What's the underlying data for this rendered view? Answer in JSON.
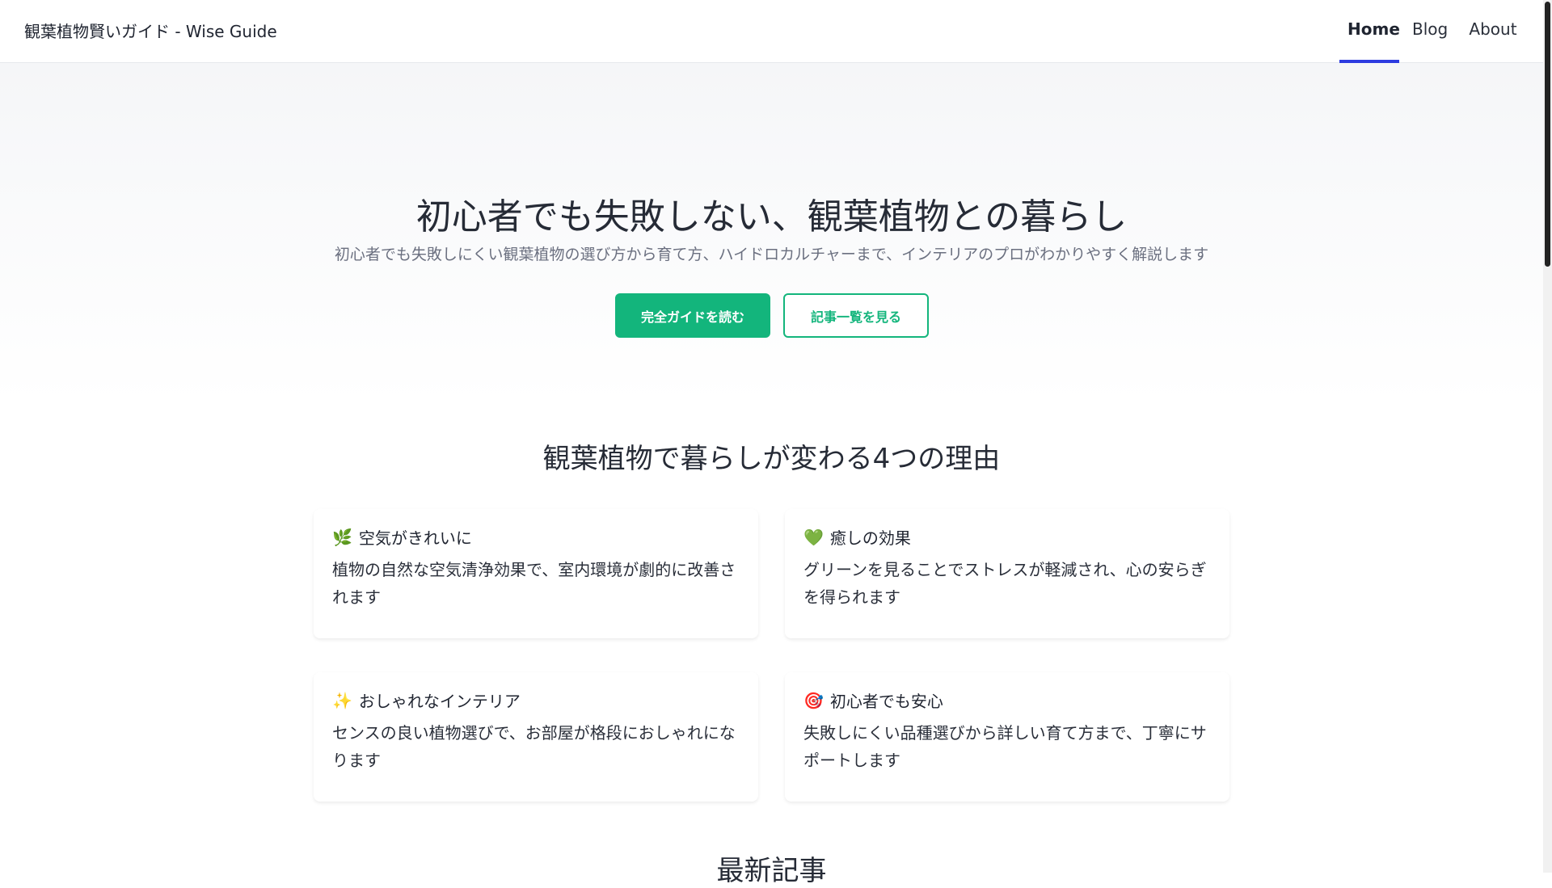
{
  "header": {
    "brand": "観葉植物賢いガイド - Wise Guide",
    "nav": [
      {
        "label": "Home",
        "active": true
      },
      {
        "label": "Blog",
        "active": false
      },
      {
        "label": "About",
        "active": false
      }
    ]
  },
  "hero": {
    "title": "初心者でも失敗しない、観葉植物との暮らし",
    "subtitle": "初心者でも失敗しにくい観葉植物の選び方から育て方、ハイドロカルチャーまで、インテリアのプロがわかりやすく解説します",
    "primary_button": "完全ガイドを読む",
    "secondary_button": "記事一覧を見る"
  },
  "reasons": {
    "title": "観葉植物で暮らしが変わる4つの理由",
    "cards": [
      {
        "icon": "🌿",
        "title": "空気がきれいに",
        "description": "植物の自然な空気清浄効果で、室内環境が劇的に改善されます"
      },
      {
        "icon": "💚",
        "title": "癒しの効果",
        "description": "グリーンを見ることでストレスが軽減され、心の安らぎを得られます"
      },
      {
        "icon": "✨",
        "title": "おしゃれなインテリア",
        "description": "センスの良い植物選びで、お部屋が格段におしゃれになります"
      },
      {
        "icon": "🎯",
        "title": "初心者でも安心",
        "description": "失敗しにくい品種選びから詳しい育て方まで、丁寧にサポートします"
      }
    ]
  },
  "latest": {
    "title": "最新記事"
  },
  "colors": {
    "accent": "#13b57c",
    "nav_active_underline": "#2d3be0"
  }
}
